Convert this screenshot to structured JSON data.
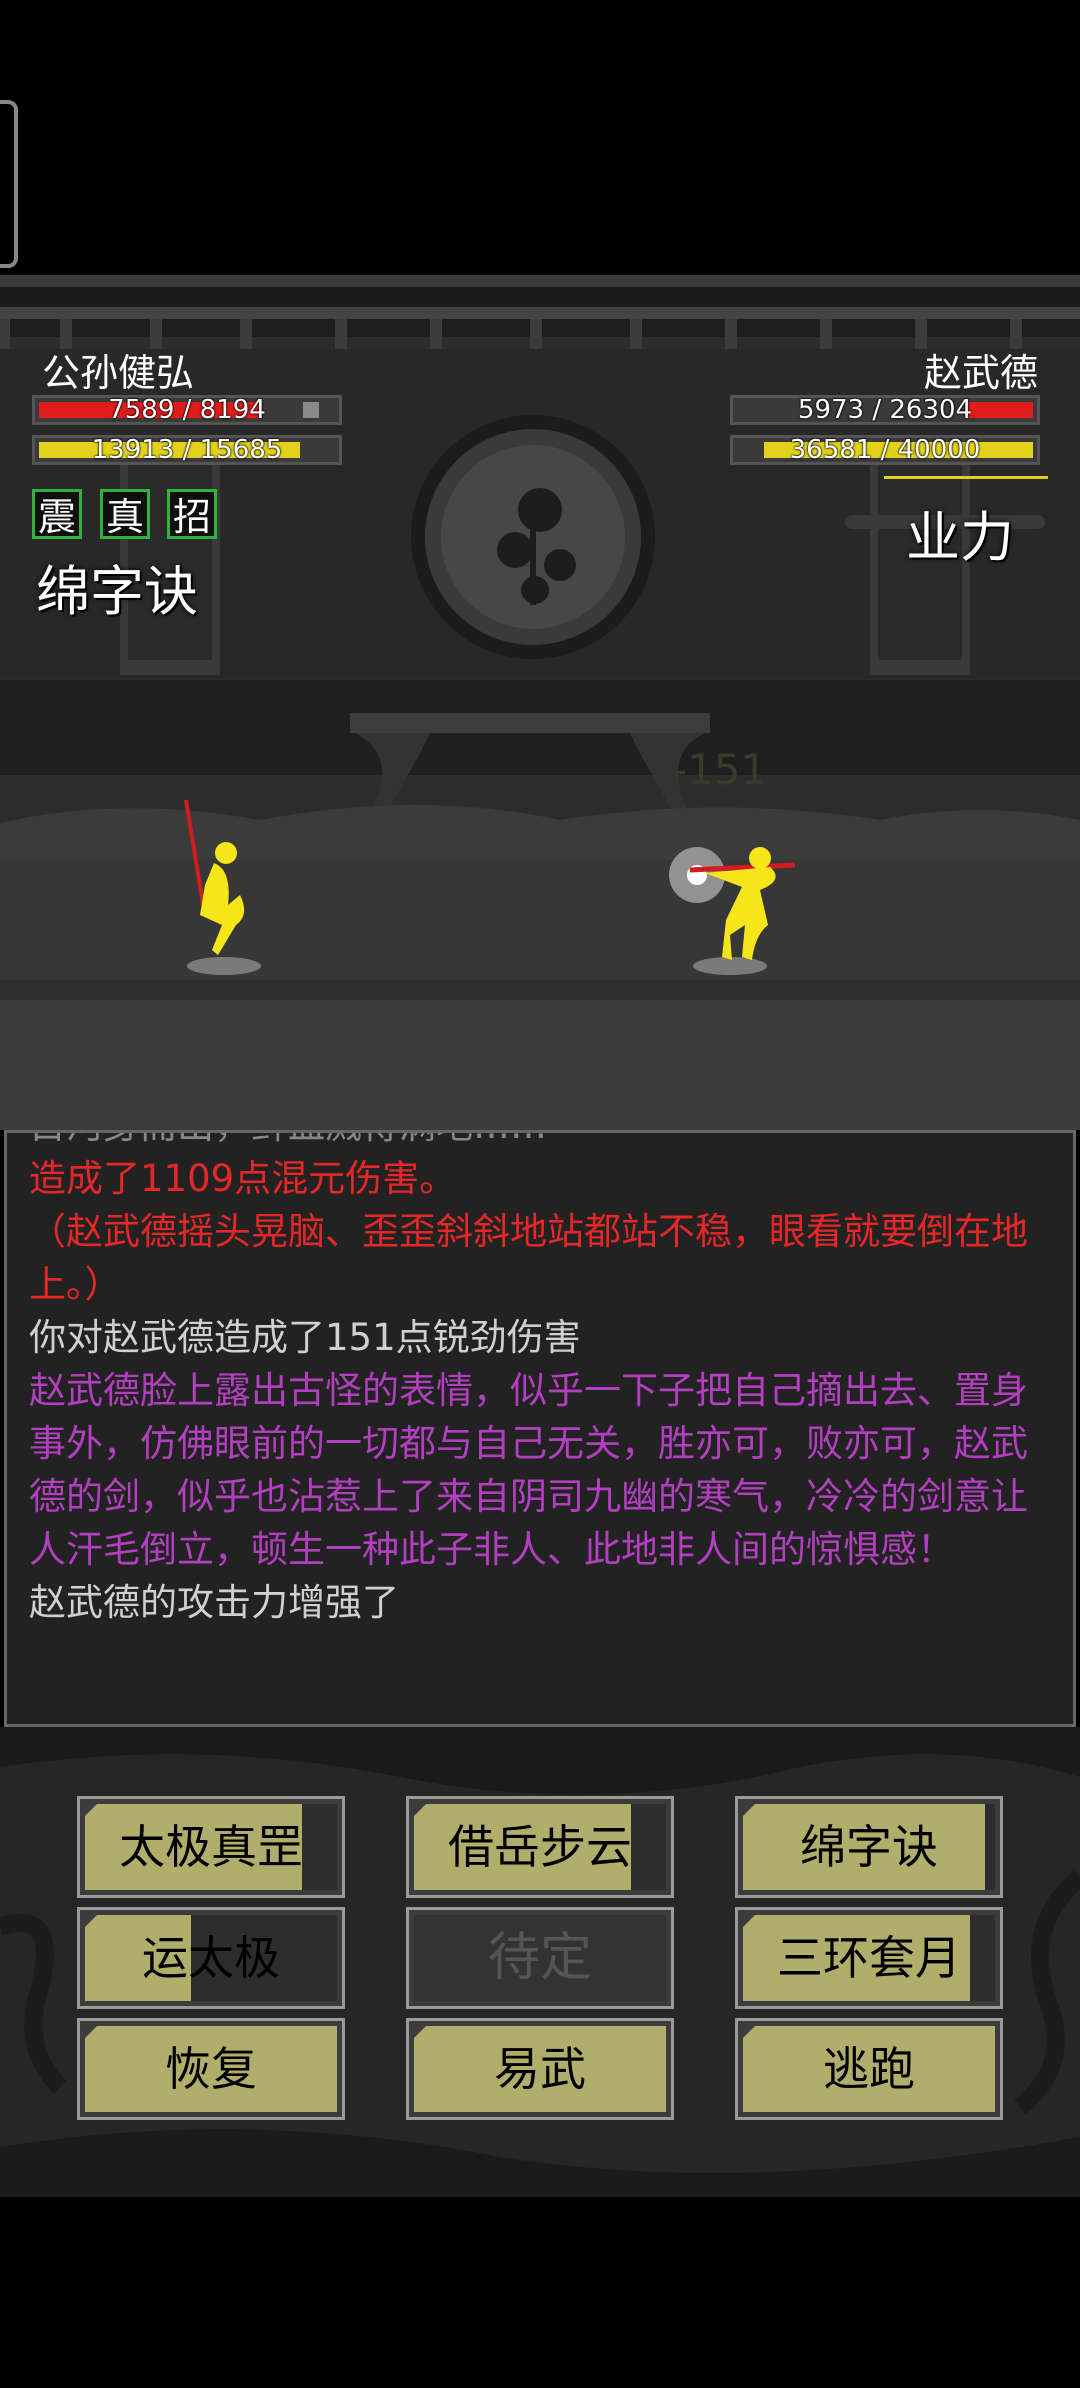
{
  "player": {
    "name": "公孙健弘",
    "hp_text": "7589 / 8194",
    "hp_fraction": 0.926,
    "mp_text": "13913 / 15685",
    "mp_fraction": 0.887,
    "skill_tags": [
      "震",
      "真",
      "招"
    ],
    "stance": "绵字诀"
  },
  "enemy": {
    "name": "赵武德",
    "hp_text": "5973 / 26304",
    "hp_fraction": 0.227,
    "mp_text": "36581 / 40000",
    "mp_fraction": 0.915,
    "stance": "业力"
  },
  "floating_damage": "-151",
  "battle_log": [
    {
      "text": "目河身而出，鲜血溅得满地……",
      "style": "clip"
    },
    {
      "text": "造成了1109点混元伤害。",
      "style": "red"
    },
    {
      "text": "（赵武德摇头晃脑、歪歪斜斜地站都站不稳，眼看就要倒在地上。）",
      "style": "red"
    },
    {
      "text": "你对赵武德造成了151点锐劲伤害",
      "style": "gray"
    },
    {
      "text": "赵武德脸上露出古怪的表情，似乎一下子把自己摘出去、置身事外，仿佛眼前的一切都与自己无关，胜亦可，败亦可，赵武德的剑，似乎也沾惹上了来自阴司九幽的寒气，冷冷的剑意让人汗毛倒立，顿生一种此子非人、此地非人间的惊惧感！",
      "style": "purple"
    },
    {
      "text": "赵武德的攻击力增强了",
      "style": "gray"
    }
  ],
  "actions": [
    {
      "label": "太极真罡",
      "cooldown": 0.0,
      "enabled": true
    },
    {
      "label": "借岳步云",
      "cooldown": 0.0,
      "enabled": true
    },
    {
      "label": "绵字诀",
      "cooldown": 0.0,
      "enabled": true
    },
    {
      "label": "运太极",
      "cooldown": 0.0,
      "enabled": true
    },
    {
      "label": "待定",
      "cooldown": 0.0,
      "enabled": false
    },
    {
      "label": "三环套月",
      "cooldown": 0.0,
      "enabled": true
    },
    {
      "label": "恢复",
      "cooldown": 0.0,
      "enabled": true
    },
    {
      "label": "易武",
      "cooldown": 0.0,
      "enabled": true
    },
    {
      "label": "逃跑",
      "cooldown": 0.0,
      "enabled": true
    }
  ],
  "colors": {
    "hp": "#e01c1c",
    "mp": "#e3d21c",
    "button": "#b1ad6a",
    "skill_tag_border": "#2eb33c",
    "fighter": "#f5e61a"
  }
}
